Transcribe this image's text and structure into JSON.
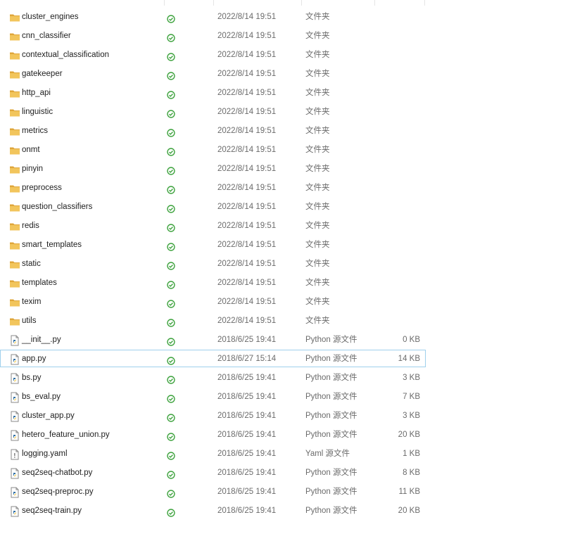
{
  "colors": {
    "folder": "#f2c55c",
    "folder_dark": "#dfa63a",
    "status_ok": "#3fa33f",
    "selection": "#9fd0ec"
  },
  "rows": [
    {
      "name": "cluster_engines",
      "icon": "folder-icon",
      "date": "2022/8/14 19:51",
      "type": "文件夹",
      "size": ""
    },
    {
      "name": "cnn_classifier",
      "icon": "folder-icon",
      "date": "2022/8/14 19:51",
      "type": "文件夹",
      "size": ""
    },
    {
      "name": "contextual_classification",
      "icon": "folder-icon",
      "date": "2022/8/14 19:51",
      "type": "文件夹",
      "size": ""
    },
    {
      "name": "gatekeeper",
      "icon": "folder-icon",
      "date": "2022/8/14 19:51",
      "type": "文件夹",
      "size": ""
    },
    {
      "name": "http_api",
      "icon": "folder-icon",
      "date": "2022/8/14 19:51",
      "type": "文件夹",
      "size": ""
    },
    {
      "name": "linguistic",
      "icon": "folder-icon",
      "date": "2022/8/14 19:51",
      "type": "文件夹",
      "size": ""
    },
    {
      "name": "metrics",
      "icon": "folder-icon",
      "date": "2022/8/14 19:51",
      "type": "文件夹",
      "size": ""
    },
    {
      "name": "onmt",
      "icon": "folder-icon",
      "date": "2022/8/14 19:51",
      "type": "文件夹",
      "size": ""
    },
    {
      "name": "pinyin",
      "icon": "folder-icon",
      "date": "2022/8/14 19:51",
      "type": "文件夹",
      "size": ""
    },
    {
      "name": "preprocess",
      "icon": "folder-icon",
      "date": "2022/8/14 19:51",
      "type": "文件夹",
      "size": ""
    },
    {
      "name": "question_classifiers",
      "icon": "folder-icon",
      "date": "2022/8/14 19:51",
      "type": "文件夹",
      "size": ""
    },
    {
      "name": "redis",
      "icon": "folder-icon",
      "date": "2022/8/14 19:51",
      "type": "文件夹",
      "size": ""
    },
    {
      "name": "smart_templates",
      "icon": "folder-icon",
      "date": "2022/8/14 19:51",
      "type": "文件夹",
      "size": ""
    },
    {
      "name": "static",
      "icon": "folder-icon",
      "date": "2022/8/14 19:51",
      "type": "文件夹",
      "size": ""
    },
    {
      "name": "templates",
      "icon": "folder-icon",
      "date": "2022/8/14 19:51",
      "type": "文件夹",
      "size": ""
    },
    {
      "name": "texim",
      "icon": "folder-icon",
      "date": "2022/8/14 19:51",
      "type": "文件夹",
      "size": ""
    },
    {
      "name": "utils",
      "icon": "folder-icon",
      "date": "2022/8/14 19:51",
      "type": "文件夹",
      "size": ""
    },
    {
      "name": "__init__.py",
      "icon": "python-file-icon",
      "date": "2018/6/25 19:41",
      "type": "Python 源文件",
      "size": "0 KB"
    },
    {
      "name": "app.py",
      "icon": "python-file-icon",
      "date": "2018/6/27 15:14",
      "type": "Python 源文件",
      "size": "14 KB",
      "selected": true
    },
    {
      "name": "bs.py",
      "icon": "python-file-icon",
      "date": "2018/6/25 19:41",
      "type": "Python 源文件",
      "size": "3 KB"
    },
    {
      "name": "bs_eval.py",
      "icon": "python-file-icon",
      "date": "2018/6/25 19:41",
      "type": "Python 源文件",
      "size": "7 KB"
    },
    {
      "name": "cluster_app.py",
      "icon": "python-file-icon",
      "date": "2018/6/25 19:41",
      "type": "Python 源文件",
      "size": "3 KB"
    },
    {
      "name": "hetero_feature_union.py",
      "icon": "python-file-icon",
      "date": "2018/6/25 19:41",
      "type": "Python 源文件",
      "size": "20 KB"
    },
    {
      "name": "logging.yaml",
      "icon": "yaml-file-icon",
      "date": "2018/6/25 19:41",
      "type": "Yaml 源文件",
      "size": "1 KB"
    },
    {
      "name": "seq2seq-chatbot.py",
      "icon": "python-file-icon",
      "date": "2018/6/25 19:41",
      "type": "Python 源文件",
      "size": "8 KB"
    },
    {
      "name": "seq2seq-preproc.py",
      "icon": "python-file-icon",
      "date": "2018/6/25 19:41",
      "type": "Python 源文件",
      "size": "11 KB"
    },
    {
      "name": "seq2seq-train.py",
      "icon": "python-file-icon",
      "date": "2018/6/25 19:41",
      "type": "Python 源文件",
      "size": "20 KB"
    }
  ]
}
